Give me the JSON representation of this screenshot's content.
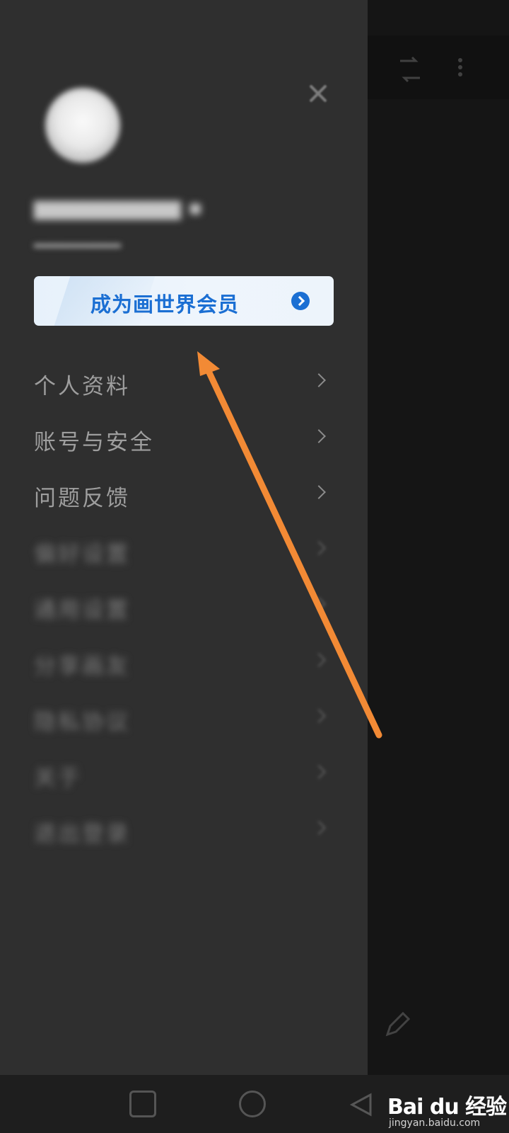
{
  "drawer": {
    "member_label": "成为画世界会员",
    "menu_items": [
      {
        "label": "个人资料",
        "blurred": false
      },
      {
        "label": "账号与安全",
        "blurred": false
      },
      {
        "label": "问题反馈",
        "blurred": false
      },
      {
        "label": "偏好设置",
        "blurred": true
      },
      {
        "label": "通用设置",
        "blurred": true
      },
      {
        "label": "分享画友",
        "blurred": true
      },
      {
        "label": "隐私协议",
        "blurred": true
      },
      {
        "label": "关于",
        "blurred": true
      },
      {
        "label": "退出登录",
        "blurred": true
      }
    ]
  },
  "annotation": {
    "color": "#f28a35"
  },
  "colors": {
    "accent": "#1b6fd3",
    "drawer_bg": "#2f2f2f"
  },
  "watermark": {
    "main": "Bai du 经验",
    "sub": "jingyan.baidu.com"
  }
}
